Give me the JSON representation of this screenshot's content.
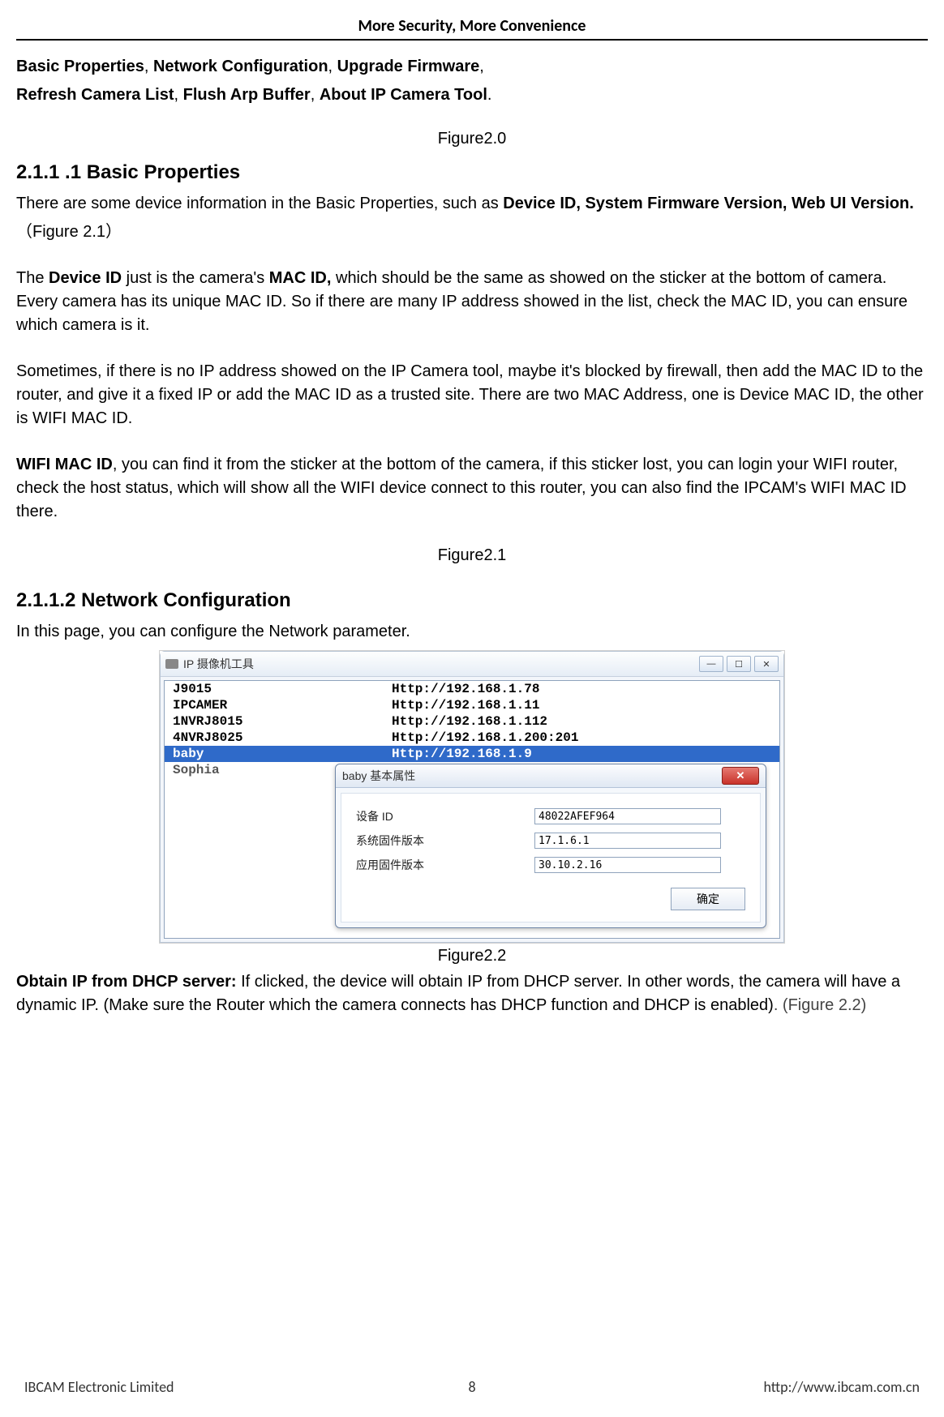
{
  "header": {
    "title": "More Security, More Convenience"
  },
  "intro": {
    "line1_items": [
      "Basic Properties",
      "Network Configuration",
      "Upgrade Firmware"
    ],
    "line2_items": [
      "Refresh Camera List",
      "Flush Arp Buffer",
      "About IP Camera Tool"
    ],
    "sep": ", ",
    "end": "."
  },
  "fig20": "Figure2.0",
  "sec211": {
    "title": "2.1.1 .1 Basic Properties",
    "p1_a": "There are some device information in the Basic Properties, such as ",
    "p1_b": "Device ID, System Firmware Version, Web UI Version.",
    "p1_c": "（Figure 2.1）",
    "p2_a": "The ",
    "p2_b": "Device ID",
    "p2_c": " just is the camera's ",
    "p2_d": "MAC ID,",
    "p2_e": " which should be the same as showed on the sticker at the bottom of camera. Every camera has its unique MAC ID. So if there are many IP address showed in the list, check the MAC ID, you can ensure which camera is it.",
    "p3": "Sometimes, if there is no IP address showed on the IP Camera tool, maybe it's blocked by firewall, then add the MAC ID to the router, and give it a fixed IP or add the MAC ID as a trusted site. There are two MAC Address, one is Device MAC ID, the other is WIFI MAC ID.",
    "p4_a": "WIFI MAC ID",
    "p4_b": ", you can find it from the sticker at the bottom of the camera, if this sticker lost, you can login your WIFI router, check the host status, which will show all the WIFI device connect to this router, you can also find the IPCAM's WIFI MAC ID there."
  },
  "fig21": "Figure2.1",
  "sec2112": {
    "title": "2.1.1.2 Network Configuration",
    "p1": "In this page, you can configure the Network parameter."
  },
  "tool": {
    "title": "IP 摄像机工具",
    "min": "—",
    "max": "☐",
    "close": "✕",
    "rows": [
      {
        "name": "J9015",
        "url": "Http://192.168.1.78",
        "sel": false
      },
      {
        "name": "IPCAMER",
        "url": "Http://192.168.1.11",
        "sel": false
      },
      {
        "name": "1NVRJ8015",
        "url": "Http://192.168.1.112",
        "sel": false
      },
      {
        "name": "4NVRJ8025",
        "url": "Http://192.168.1.200:201",
        "sel": false
      },
      {
        "name": "baby",
        "url": "Http://192.168.1.9",
        "sel": true
      },
      {
        "name": "Sophia",
        "url": "",
        "sel": false
      }
    ]
  },
  "dlg": {
    "title": "baby 基本属性",
    "close": "✕",
    "rows": [
      {
        "label": "设备 ID",
        "value": "48022AFEF964"
      },
      {
        "label": "系统固件版本",
        "value": "17.1.6.1"
      },
      {
        "label": "应用固件版本",
        "value": "30.10.2.16"
      }
    ],
    "ok": "确定"
  },
  "fig22": "Figure2.2",
  "dhcp": {
    "a": "Obtain IP from DHCP server:",
    "b": " If clicked, the device will obtain IP from DHCP server. In other words, the camera will have a dynamic IP. (Make sure the Router which the camera connects has DHCP function and DHCP is enabled)",
    "c": ". (Figure 2.2)"
  },
  "footer": {
    "left": "IBCAM Electronic Limited",
    "page": "8",
    "right": "http://www.ibcam.com.cn"
  }
}
